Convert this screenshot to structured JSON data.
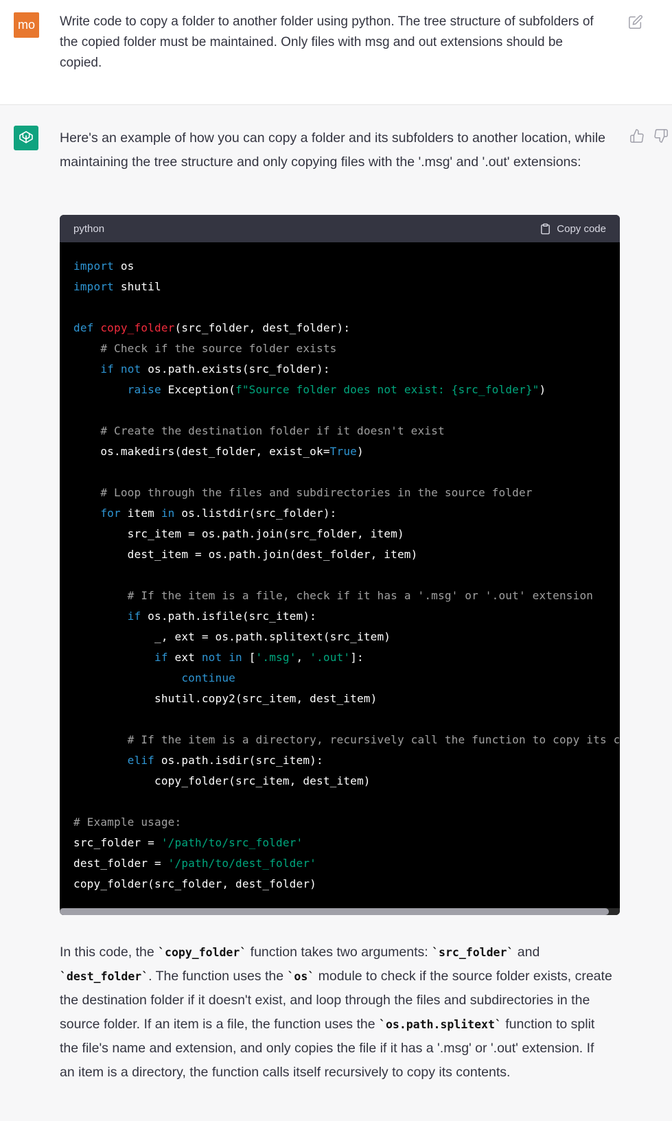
{
  "user_message": {
    "avatar_initials": "mo",
    "text": "Write code to copy a folder to another folder using python. The tree structure of subfolders of the copied folder must be maintained. Only files with msg and out extensions should be copied."
  },
  "assistant_message": {
    "intro": "Here's an example of how you can copy a folder and its subfolders to another location, while maintaining the tree structure and only copying files with the '.msg' and '.out' extensions:",
    "code_block": {
      "language": "python",
      "copy_label": "Copy code",
      "lines": [
        [
          {
            "t": "import",
            "c": "kw"
          },
          {
            "t": " os",
            "c": ""
          }
        ],
        [
          {
            "t": "import",
            "c": "kw"
          },
          {
            "t": " shutil",
            "c": ""
          }
        ],
        [],
        [
          {
            "t": "def ",
            "c": "kw"
          },
          {
            "t": "copy_folder",
            "c": "fn"
          },
          {
            "t": "(src_folder, dest_folder):",
            "c": ""
          }
        ],
        [
          {
            "t": "    ",
            "c": ""
          },
          {
            "t": "# Check if the source folder exists",
            "c": "cm"
          }
        ],
        [
          {
            "t": "    ",
            "c": ""
          },
          {
            "t": "if",
            "c": "kw"
          },
          {
            "t": " ",
            "c": ""
          },
          {
            "t": "not",
            "c": "kw"
          },
          {
            "t": " os.path.exists(src_folder):",
            "c": ""
          }
        ],
        [
          {
            "t": "        ",
            "c": ""
          },
          {
            "t": "raise",
            "c": "kw"
          },
          {
            "t": " Exception(",
            "c": ""
          },
          {
            "t": "f\"Source folder does not exist: {src_folder}\"",
            "c": "st"
          },
          {
            "t": ")",
            "c": ""
          }
        ],
        [],
        [
          {
            "t": "    ",
            "c": ""
          },
          {
            "t": "# Create the destination folder if it doesn't exist",
            "c": "cm"
          }
        ],
        [
          {
            "t": "    os.makedirs(dest_folder, exist_ok=",
            "c": ""
          },
          {
            "t": "True",
            "c": "kw"
          },
          {
            "t": ")",
            "c": ""
          }
        ],
        [],
        [
          {
            "t": "    ",
            "c": ""
          },
          {
            "t": "# Loop through the files and subdirectories in the source folder",
            "c": "cm"
          }
        ],
        [
          {
            "t": "    ",
            "c": ""
          },
          {
            "t": "for",
            "c": "kw"
          },
          {
            "t": " item ",
            "c": ""
          },
          {
            "t": "in",
            "c": "kw"
          },
          {
            "t": " os.listdir(src_folder):",
            "c": ""
          }
        ],
        [
          {
            "t": "        src_item = os.path.join(src_folder, item)",
            "c": ""
          }
        ],
        [
          {
            "t": "        dest_item = os.path.join(dest_folder, item)",
            "c": ""
          }
        ],
        [],
        [
          {
            "t": "        ",
            "c": ""
          },
          {
            "t": "# If the item is a file, check if it has a '.msg' or '.out' extension",
            "c": "cm"
          }
        ],
        [
          {
            "t": "        ",
            "c": ""
          },
          {
            "t": "if",
            "c": "kw"
          },
          {
            "t": " os.path.isfile(src_item):",
            "c": ""
          }
        ],
        [
          {
            "t": "            _, ext = os.path.splitext(src_item)",
            "c": ""
          }
        ],
        [
          {
            "t": "            ",
            "c": ""
          },
          {
            "t": "if",
            "c": "kw"
          },
          {
            "t": " ext ",
            "c": ""
          },
          {
            "t": "not",
            "c": "kw"
          },
          {
            "t": " ",
            "c": ""
          },
          {
            "t": "in",
            "c": "kw"
          },
          {
            "t": " [",
            "c": ""
          },
          {
            "t": "'.msg'",
            "c": "st"
          },
          {
            "t": ", ",
            "c": ""
          },
          {
            "t": "'.out'",
            "c": "st"
          },
          {
            "t": "]:",
            "c": ""
          }
        ],
        [
          {
            "t": "                ",
            "c": ""
          },
          {
            "t": "continue",
            "c": "kw"
          }
        ],
        [
          {
            "t": "            shutil.copy2(src_item, dest_item)",
            "c": ""
          }
        ],
        [],
        [
          {
            "t": "        ",
            "c": ""
          },
          {
            "t": "# If the item is a directory, recursively call the function to copy its contents",
            "c": "cm"
          }
        ],
        [
          {
            "t": "        ",
            "c": ""
          },
          {
            "t": "elif",
            "c": "kw"
          },
          {
            "t": " os.path.isdir(src_item):",
            "c": ""
          }
        ],
        [
          {
            "t": "            copy_folder(src_item, dest_item)",
            "c": ""
          }
        ],
        [],
        [
          {
            "t": "# Example usage:",
            "c": "cm"
          }
        ],
        [
          {
            "t": "src_folder = ",
            "c": ""
          },
          {
            "t": "'/path/to/src_folder'",
            "c": "st"
          }
        ],
        [
          {
            "t": "dest_folder = ",
            "c": ""
          },
          {
            "t": "'/path/to/dest_folder'",
            "c": "st"
          }
        ],
        [
          {
            "t": "copy_folder(src_folder, dest_folder)",
            "c": ""
          }
        ]
      ]
    },
    "explanation": [
      {
        "t": "In this code, the ",
        "c": ""
      },
      {
        "t": "`copy_folder`",
        "c": "ic"
      },
      {
        "t": " function takes two arguments: ",
        "c": ""
      },
      {
        "t": "`src_folder`",
        "c": "ic"
      },
      {
        "t": " and ",
        "c": ""
      },
      {
        "t": "`dest_folder`",
        "c": "ic"
      },
      {
        "t": ". The function uses the ",
        "c": ""
      },
      {
        "t": "`os`",
        "c": "ic"
      },
      {
        "t": " module to check if the source folder exists, create the destination folder if it doesn't exist, and loop through the files and subdirectories in the source folder. If an item is a file, the function uses the ",
        "c": ""
      },
      {
        "t": "`os.path.splitext`",
        "c": "ic"
      },
      {
        "t": " function to split the file's name and extension, and only copies the file if it has a '.msg' or '.out' extension. If an item is a directory, the function calls itself recursively to copy its contents.",
        "c": ""
      }
    ]
  },
  "icons": {
    "edit": "edit-icon",
    "thumbs_up": "thumbs-up-icon",
    "thumbs_down": "thumbs-down-icon",
    "clipboard": "clipboard-icon",
    "bot_logo": "openai-logo-icon"
  },
  "colors": {
    "user_avatar": "#e8772e",
    "bot_avatar": "#10a37f",
    "code_bg": "#000000",
    "code_header_bg": "#343541",
    "keyword": "#2e95d3",
    "function_name": "#f22c3d",
    "comment": "#a0a0a0",
    "string": "#00a67d"
  }
}
